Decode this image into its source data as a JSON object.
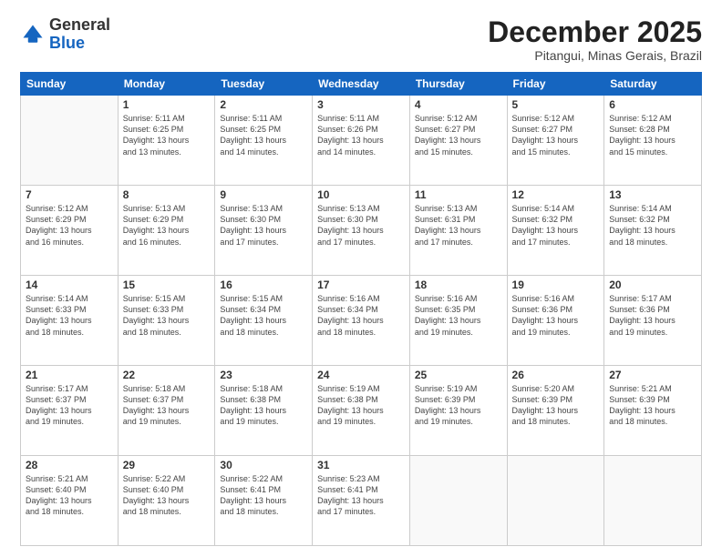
{
  "logo": {
    "general": "General",
    "blue": "Blue"
  },
  "header": {
    "month": "December 2025",
    "location": "Pitangui, Minas Gerais, Brazil"
  },
  "weekdays": [
    "Sunday",
    "Monday",
    "Tuesday",
    "Wednesday",
    "Thursday",
    "Friday",
    "Saturday"
  ],
  "weeks": [
    [
      {
        "day": "",
        "info": ""
      },
      {
        "day": "1",
        "info": "Sunrise: 5:11 AM\nSunset: 6:25 PM\nDaylight: 13 hours\nand 13 minutes."
      },
      {
        "day": "2",
        "info": "Sunrise: 5:11 AM\nSunset: 6:25 PM\nDaylight: 13 hours\nand 14 minutes."
      },
      {
        "day": "3",
        "info": "Sunrise: 5:11 AM\nSunset: 6:26 PM\nDaylight: 13 hours\nand 14 minutes."
      },
      {
        "day": "4",
        "info": "Sunrise: 5:12 AM\nSunset: 6:27 PM\nDaylight: 13 hours\nand 15 minutes."
      },
      {
        "day": "5",
        "info": "Sunrise: 5:12 AM\nSunset: 6:27 PM\nDaylight: 13 hours\nand 15 minutes."
      },
      {
        "day": "6",
        "info": "Sunrise: 5:12 AM\nSunset: 6:28 PM\nDaylight: 13 hours\nand 15 minutes."
      }
    ],
    [
      {
        "day": "7",
        "info": "Sunrise: 5:12 AM\nSunset: 6:29 PM\nDaylight: 13 hours\nand 16 minutes."
      },
      {
        "day": "8",
        "info": "Sunrise: 5:13 AM\nSunset: 6:29 PM\nDaylight: 13 hours\nand 16 minutes."
      },
      {
        "day": "9",
        "info": "Sunrise: 5:13 AM\nSunset: 6:30 PM\nDaylight: 13 hours\nand 17 minutes."
      },
      {
        "day": "10",
        "info": "Sunrise: 5:13 AM\nSunset: 6:30 PM\nDaylight: 13 hours\nand 17 minutes."
      },
      {
        "day": "11",
        "info": "Sunrise: 5:13 AM\nSunset: 6:31 PM\nDaylight: 13 hours\nand 17 minutes."
      },
      {
        "day": "12",
        "info": "Sunrise: 5:14 AM\nSunset: 6:32 PM\nDaylight: 13 hours\nand 17 minutes."
      },
      {
        "day": "13",
        "info": "Sunrise: 5:14 AM\nSunset: 6:32 PM\nDaylight: 13 hours\nand 18 minutes."
      }
    ],
    [
      {
        "day": "14",
        "info": "Sunrise: 5:14 AM\nSunset: 6:33 PM\nDaylight: 13 hours\nand 18 minutes."
      },
      {
        "day": "15",
        "info": "Sunrise: 5:15 AM\nSunset: 6:33 PM\nDaylight: 13 hours\nand 18 minutes."
      },
      {
        "day": "16",
        "info": "Sunrise: 5:15 AM\nSunset: 6:34 PM\nDaylight: 13 hours\nand 18 minutes."
      },
      {
        "day": "17",
        "info": "Sunrise: 5:16 AM\nSunset: 6:34 PM\nDaylight: 13 hours\nand 18 minutes."
      },
      {
        "day": "18",
        "info": "Sunrise: 5:16 AM\nSunset: 6:35 PM\nDaylight: 13 hours\nand 19 minutes."
      },
      {
        "day": "19",
        "info": "Sunrise: 5:16 AM\nSunset: 6:36 PM\nDaylight: 13 hours\nand 19 minutes."
      },
      {
        "day": "20",
        "info": "Sunrise: 5:17 AM\nSunset: 6:36 PM\nDaylight: 13 hours\nand 19 minutes."
      }
    ],
    [
      {
        "day": "21",
        "info": "Sunrise: 5:17 AM\nSunset: 6:37 PM\nDaylight: 13 hours\nand 19 minutes."
      },
      {
        "day": "22",
        "info": "Sunrise: 5:18 AM\nSunset: 6:37 PM\nDaylight: 13 hours\nand 19 minutes."
      },
      {
        "day": "23",
        "info": "Sunrise: 5:18 AM\nSunset: 6:38 PM\nDaylight: 13 hours\nand 19 minutes."
      },
      {
        "day": "24",
        "info": "Sunrise: 5:19 AM\nSunset: 6:38 PM\nDaylight: 13 hours\nand 19 minutes."
      },
      {
        "day": "25",
        "info": "Sunrise: 5:19 AM\nSunset: 6:39 PM\nDaylight: 13 hours\nand 19 minutes."
      },
      {
        "day": "26",
        "info": "Sunrise: 5:20 AM\nSunset: 6:39 PM\nDaylight: 13 hours\nand 18 minutes."
      },
      {
        "day": "27",
        "info": "Sunrise: 5:21 AM\nSunset: 6:39 PM\nDaylight: 13 hours\nand 18 minutes."
      }
    ],
    [
      {
        "day": "28",
        "info": "Sunrise: 5:21 AM\nSunset: 6:40 PM\nDaylight: 13 hours\nand 18 minutes."
      },
      {
        "day": "29",
        "info": "Sunrise: 5:22 AM\nSunset: 6:40 PM\nDaylight: 13 hours\nand 18 minutes."
      },
      {
        "day": "30",
        "info": "Sunrise: 5:22 AM\nSunset: 6:41 PM\nDaylight: 13 hours\nand 18 minutes."
      },
      {
        "day": "31",
        "info": "Sunrise: 5:23 AM\nSunset: 6:41 PM\nDaylight: 13 hours\nand 17 minutes."
      },
      {
        "day": "",
        "info": ""
      },
      {
        "day": "",
        "info": ""
      },
      {
        "day": "",
        "info": ""
      }
    ]
  ]
}
